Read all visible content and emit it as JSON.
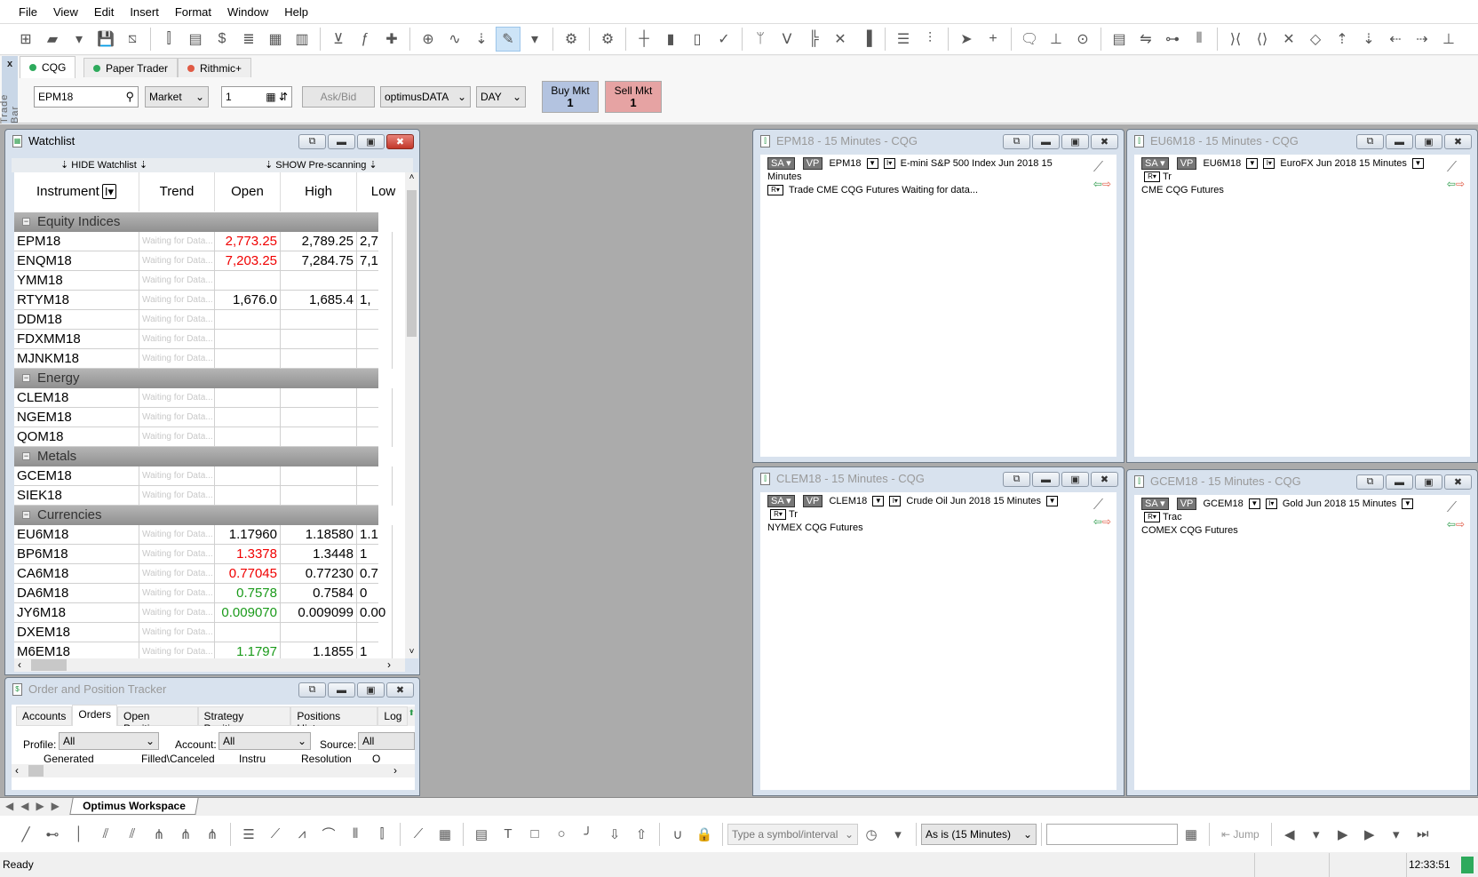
{
  "menu": [
    "File",
    "View",
    "Edit",
    "Insert",
    "Format",
    "Window",
    "Help"
  ],
  "toolbar": {
    "groups": [
      [
        "new-window-icon",
        "folder-icon",
        "dropdown-arrow-icon",
        "save-icon",
        "close-page-icon"
      ],
      [
        "chart-icon",
        "quote-board-icon",
        "dom-icon",
        "news-icon",
        "heatmap-icon",
        "spreadsheet-icon"
      ],
      [
        "import-icon",
        "formula-icon",
        "plugin-icon"
      ],
      [
        "add-study-icon",
        "add-curve-icon",
        "add-indicator-icon",
        "draw-pen-icon",
        "dropdown-arrow-icon"
      ],
      [
        "settings-icon"
      ],
      [
        "chart-settings-icon"
      ],
      [
        "bar-chart-icon",
        "candlestick-icon",
        "hollow-candle-icon",
        "line-chart-icon"
      ],
      [
        "range-bar-icon",
        "kagi-icon",
        "renko-icon",
        "point-figure-icon",
        "equivolume-icon"
      ],
      [
        "volume-profile-icon",
        "market-profile-icon"
      ],
      [
        "cursor-icon",
        "crosshair-icon"
      ],
      [
        "comment-icon",
        "horizontal-line-icon",
        "magnifier-icon"
      ],
      [
        "table-icon",
        "compare-icon",
        "ruler-icon",
        "tick-marks-icon"
      ],
      [
        "zoom-in-x-icon",
        "zoom-out-x-icon",
        "reset-zoom-icon",
        "zoom-y-icon",
        "scroll-up-icon",
        "scroll-down-icon",
        "scroll-left-icon",
        "scroll-right-icon",
        "anchor-icon"
      ]
    ],
    "active": "draw-pen-icon"
  },
  "tradebar": {
    "side_label": "Trade Bar",
    "close": "x",
    "tabs": [
      {
        "label": "CQG",
        "color": "#2eaa5c"
      },
      {
        "label": "Paper Trader",
        "color": "#2eaa5c"
      },
      {
        "label": "Rithmic+",
        "color": "#e05a44"
      }
    ],
    "symbol": "EPM18",
    "order_type": "Market",
    "quantity": "1",
    "price_source": "Ask/Bid",
    "account": "optimusDATA",
    "duration": "DAY",
    "buy": {
      "label": "Buy Mkt",
      "qty": "1",
      "color": "#b3c3e0"
    },
    "sell": {
      "label": "Sell Mkt",
      "qty": "1",
      "color": "#e6a3a3"
    }
  },
  "watchlist": {
    "title": "Watchlist",
    "hide_label": "HIDE Watchlist",
    "show_label": "SHOW Pre-scanning",
    "columns": [
      "Instrument",
      "Trend",
      "Open",
      "High",
      "Low"
    ],
    "waiting": "Waiting for Data...",
    "groups": [
      {
        "name": "Equity Indices",
        "rows": [
          {
            "sym": "EPM18",
            "open": "2,773.25",
            "high": "2,789.25",
            "low": "2,7",
            "color": "red"
          },
          {
            "sym": "ENQM18",
            "open": "7,203.25",
            "high": "7,284.75",
            "low": "7,1",
            "color": "red"
          },
          {
            "sym": "YMM18",
            "open": "",
            "high": "",
            "low": ""
          },
          {
            "sym": "RTYM18",
            "open": "1,676.0",
            "high": "1,685.4",
            "low": "1,"
          },
          {
            "sym": "DDM18",
            "open": "",
            "high": "",
            "low": ""
          },
          {
            "sym": "FDXMM18",
            "open": "",
            "high": "",
            "low": ""
          },
          {
            "sym": "MJNKM18",
            "open": "",
            "high": "",
            "low": ""
          }
        ]
      },
      {
        "name": "Energy",
        "rows": [
          {
            "sym": "CLEM18",
            "open": "",
            "high": "",
            "low": ""
          },
          {
            "sym": "NGEM18",
            "open": "",
            "high": "",
            "low": ""
          },
          {
            "sym": "QOM18",
            "open": "",
            "high": "",
            "low": ""
          }
        ]
      },
      {
        "name": "Metals",
        "rows": [
          {
            "sym": "GCEM18",
            "open": "",
            "high": "",
            "low": ""
          },
          {
            "sym": "SIEK18",
            "open": "",
            "high": "",
            "low": ""
          }
        ]
      },
      {
        "name": "Currencies",
        "rows": [
          {
            "sym": "EU6M18",
            "open": "1.17960",
            "high": "1.18580",
            "low": "1.1"
          },
          {
            "sym": "BP6M18",
            "open": "1.3378",
            "high": "1.3448",
            "low": "1",
            "color": "red"
          },
          {
            "sym": "CA6M18",
            "open": "0.77045",
            "high": "0.77230",
            "low": "0.7",
            "color": "red"
          },
          {
            "sym": "DA6M18",
            "open": "0.7578",
            "high": "0.7584",
            "low": "0",
            "color": "green"
          },
          {
            "sym": "JY6M18",
            "open": "0.009070",
            "high": "0.009099",
            "low": "0.00",
            "color": "green"
          },
          {
            "sym": "DXEM18",
            "open": "",
            "high": "",
            "low": ""
          },
          {
            "sym": "M6EM18",
            "open": "1.1797",
            "high": "1.1855",
            "low": "1",
            "color": "green"
          }
        ]
      }
    ],
    "colors": {
      "red": "#f00000",
      "green": "#1a9a1a"
    }
  },
  "tracker": {
    "title": "Order and Position Tracker",
    "tabs": [
      "Accounts",
      "Orders",
      "Open Positions",
      "Strategy Positions",
      "Positions History",
      "Log"
    ],
    "selected": "Orders",
    "profile_label": "Profile:",
    "profile": "All",
    "account_label": "Account:",
    "account": "All",
    "source_label": "Source:",
    "source": "All",
    "columns": [
      "Generated",
      "Filled\\Canceled",
      "Instru",
      "Resolution",
      "O"
    ]
  },
  "charts": [
    {
      "title": "EPM18 - 15 Minutes - CQG",
      "line1": [
        "EPM18",
        "E-mini S&P 500 Index Jun 2018  15 Minutes"
      ],
      "line2": "Trade  CME  CQG  Futures  Waiting for data...",
      "r_first": true
    },
    {
      "title": "EU6M18 - 15 Minutes - CQG",
      "line1": [
        "EU6M18",
        "EuroFX Jun 2018  15 Minutes",
        "Tr"
      ],
      "line2": "CME  CQG  Futures"
    },
    {
      "title": "CLEM18 - 15 Minutes - CQG",
      "line1": [
        "CLEM18",
        "Crude Oil Jun 2018  15 Minutes",
        "Tr"
      ],
      "line2": "NYMEX  CQG  Futures"
    },
    {
      "title": "GCEM18 - 15 Minutes - CQG",
      "line1": [
        "GCEM18",
        "Gold Jun 2018  15 Minutes",
        "Trac"
      ],
      "line2": "COMEX  CQG  Futures"
    }
  ],
  "chart_btn": {
    "sa": "SA",
    "vp": "VP",
    "r": "R"
  },
  "workspace_tab": "Optimus Workspace",
  "drawbar": {
    "icons": [
      [
        "line-icon",
        "horizontal-segment-icon",
        "vertical-line-icon",
        "parallel-channel-icon",
        "channel-icon",
        "pitchfork-icon",
        "schiff-pitchfork-icon",
        "modified-pitchfork-icon"
      ],
      [
        "horizontal-lines-icon",
        "fan-icon",
        "elliott-wave-icon",
        "arc-icon",
        "vertical-lines-icon",
        "time-cycles-icon"
      ],
      [
        "speed-lines-icon",
        "grid-icon"
      ],
      [
        "calculator-icon",
        "text-icon",
        "rectangle-icon",
        "ellipse-icon",
        "curve-icon",
        "arrow-down-icon",
        "arrow-up-icon"
      ],
      [
        "magnet-icon",
        "lock-draw-icon"
      ]
    ],
    "symbol_placeholder": "Type a symbol/interval",
    "interval": "As is (15 Minutes)",
    "jump": "Jump"
  },
  "status": {
    "text": "Ready",
    "time": "12:33:51",
    "indicator_color": "#2eaa5c"
  }
}
